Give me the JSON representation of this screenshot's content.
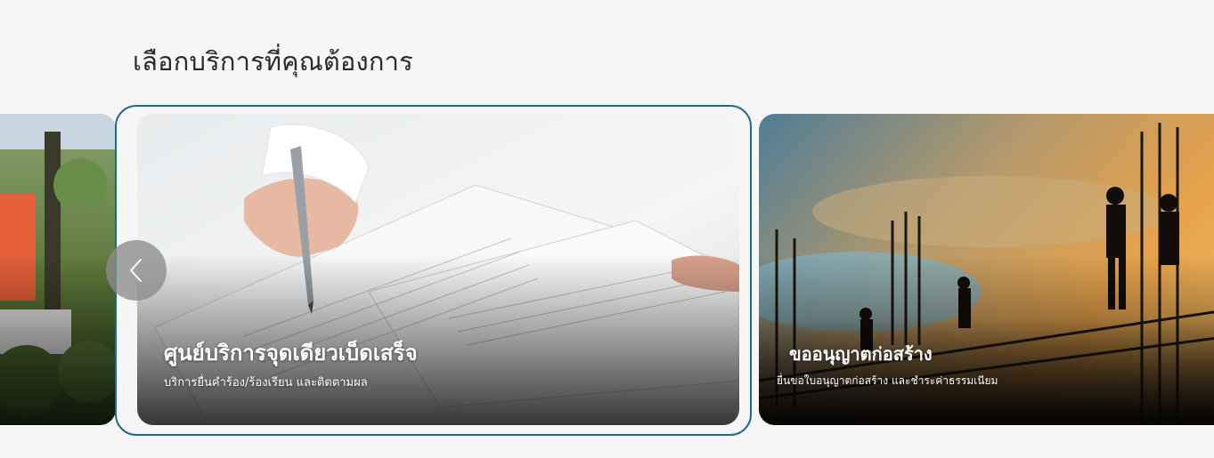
{
  "section": {
    "title": "เลือกบริการที่คุณต้องการ"
  },
  "carousel": {
    "prev_icon": "chevron-left-icon",
    "cards": [
      {
        "id": "left",
        "title": "",
        "description": ""
      },
      {
        "id": "center",
        "title": "ศูนย์บริการจุดเดียวเบ็ดเสร็จ",
        "description": "บริการยื่นคำร้อง/ร้องเรียน และติดตามผล"
      },
      {
        "id": "right",
        "title": "ขออนุญาตก่อสร้าง",
        "description": "ยื่นขอใบอนุญาตก่อสร้าง และชำระค่าธรรมเนียม"
      }
    ]
  },
  "colors": {
    "focus_ring": "#1e6a8a",
    "background": "#f6f6f6"
  }
}
